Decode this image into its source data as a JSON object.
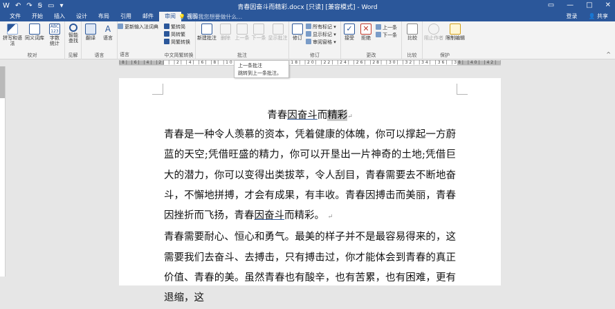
{
  "window": {
    "title": "青春因奋斗而精彩.docx [只读] [兼容模式] - Word",
    "controls": [
      "▭",
      "—",
      "□",
      "✕"
    ]
  },
  "qat": [
    "W",
    "↶",
    "↷",
    "Ꞩ",
    "▭",
    "▾"
  ],
  "tabs": [
    "文件",
    "开始",
    "插入",
    "设计",
    "布局",
    "引用",
    "邮件",
    "审阅",
    "视图"
  ],
  "active_tab": "审阅",
  "tell_me": "告诉我您想要做什么...",
  "user": {
    "signin": "登录",
    "share": "共享"
  },
  "ribbon": {
    "proofing": {
      "label": "校对",
      "spell": "拼写和语法",
      "thesaurus": "同义词库",
      "wordcount": "字数统计"
    },
    "insights": {
      "label": "见解",
      "smart_lookup": "智能查找"
    },
    "language": {
      "label": "语言",
      "translate": "翻译",
      "language": "语言"
    },
    "chinese": {
      "label": "中文简繁转换",
      "to_trad": "繁转简",
      "to_simp": "简转繁",
      "convert": "简繁转换"
    },
    "update_ime": "更新输入法词典",
    "comments": {
      "label": "批注",
      "new": "新建批注",
      "delete": "删除",
      "previous": "上一条",
      "next": "下一条",
      "show": "显示批注"
    },
    "tracking": {
      "label": "修订",
      "track": "修订",
      "markup": "所有标记",
      "show_markup": "显示标记",
      "pane": "审阅窗格"
    },
    "changes": {
      "label": "更改",
      "accept": "接受",
      "reject": "拒绝",
      "prev": "上一条",
      "next": "下一条"
    },
    "compare": {
      "label": "比较",
      "compare": "比较"
    },
    "protect": {
      "label": "保护",
      "block": "阻止作者",
      "restrict": "限制编辑"
    }
  },
  "ruler_text": "|8| |6| |4| |2| | |2| |4| |6| |8| |10| |12| |14| |16| |18| |20| |22| |24| |26| |28| |30| |32| |34| |36| |38| |40| |42| |46| |48|",
  "tooltip": {
    "title": "上一条批注",
    "desc": "跳转到上一条批注。"
  },
  "document": {
    "title_pre": "青春",
    "title_u": "因奋斗",
    "title_mid": "而",
    "title_hl": "精彩",
    "para1_a": "青春是一种令人羡慕的资本，凭着健康的体魄，你可以撑起一方蔚蓝的天空;凭借旺盛的精力，你可以开垦出一片神奇的土地;凭借巨大的潜力，你可以变得出类拔萃，令人刮目，青春需要去不断地奋斗，不懈地拼搏，才会有成果，有丰收。青春因搏击而美丽，青春因挫折而飞扬，青春",
    "para1_u": "因奋斗",
    "para1_b": "而精彩。",
    "para2": "青春需要耐心、恒心和勇气。最美的样子并不是最容易得来的，这需要我们去奋斗、去搏击，只有搏击过，你才能体会到青春的真正价值、青春的美。虽然青春也有酸辛，也有苦累，也有困难，更有退缩，这"
  }
}
